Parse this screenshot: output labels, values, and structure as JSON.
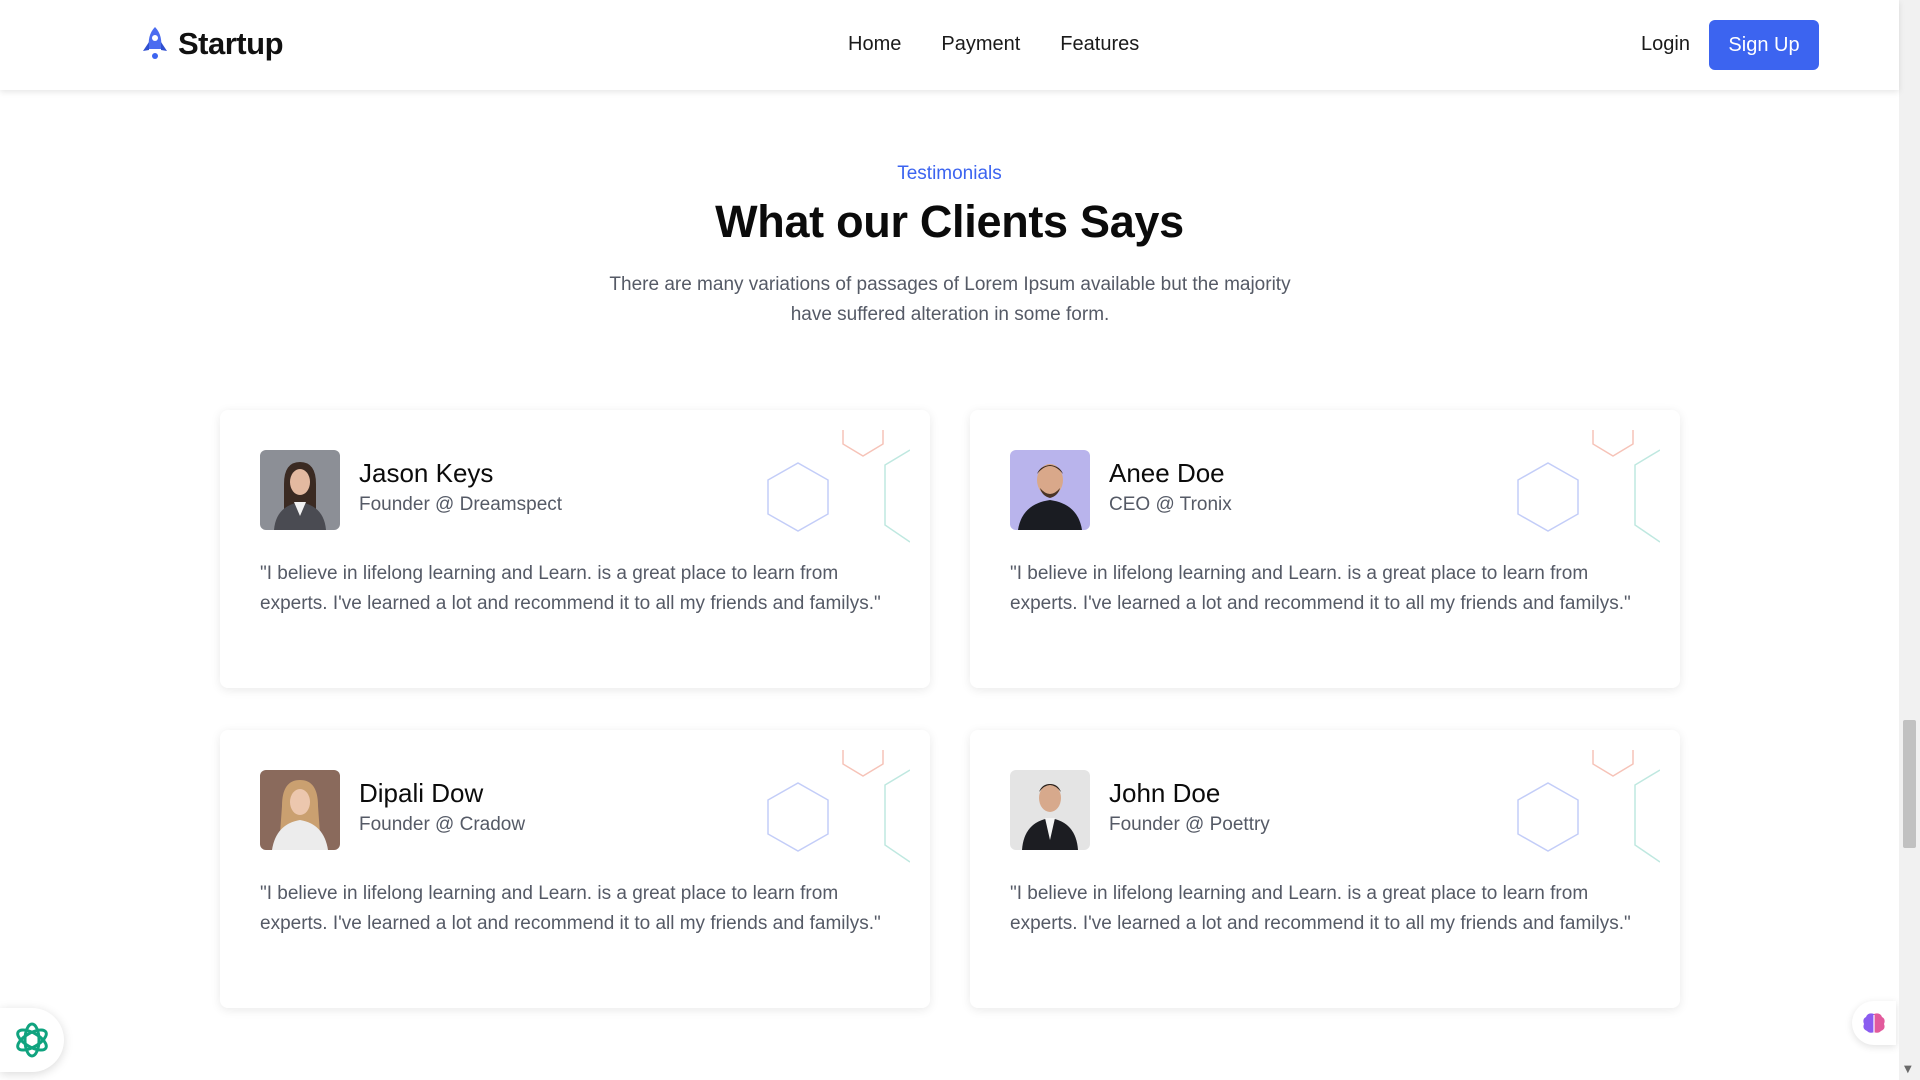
{
  "header": {
    "brand": "Startup",
    "nav": [
      "Home",
      "Payment",
      "Features"
    ],
    "login_label": "Login",
    "signup_label": "Sign Up"
  },
  "section": {
    "eyebrow": "Testimonials",
    "title": "What our Clients Says",
    "subtitle": "There are many variations of passages of Lorem Ipsum available but the majority have suffered alteration in some form."
  },
  "testimonials": [
    {
      "name": "Jason Keys",
      "role": "Founder @ Dreamspect",
      "quote": "\"I believe in lifelong learning and Learn. is a great place to learn from experts. I've learned a lot and recommend it to all my friends and familys.\""
    },
    {
      "name": "Anee Doe",
      "role": "CEO @ Tronix",
      "quote": "\"I believe in lifelong learning and Learn. is a great place to learn from experts. I've learned a lot and recommend it to all my friends and familys.\""
    },
    {
      "name": "Dipali Dow",
      "role": "Founder @ Cradow",
      "quote": "\"I believe in lifelong learning and Learn. is a great place to learn from experts. I've learned a lot and recommend it to all my friends and familys.\""
    },
    {
      "name": "John Doe",
      "role": "Founder @ Poettry",
      "quote": "\"I believe in lifelong learning and Learn. is a great place to learn from experts. I've learned a lot and recommend it to all my friends and familys.\""
    }
  ],
  "icons": {
    "logo": "rocket-icon",
    "left_widget": "ai-assistant-icon",
    "right_widget": "brain-icon"
  },
  "colors": {
    "accent": "#3c64f0",
    "text_muted": "#555a66"
  }
}
